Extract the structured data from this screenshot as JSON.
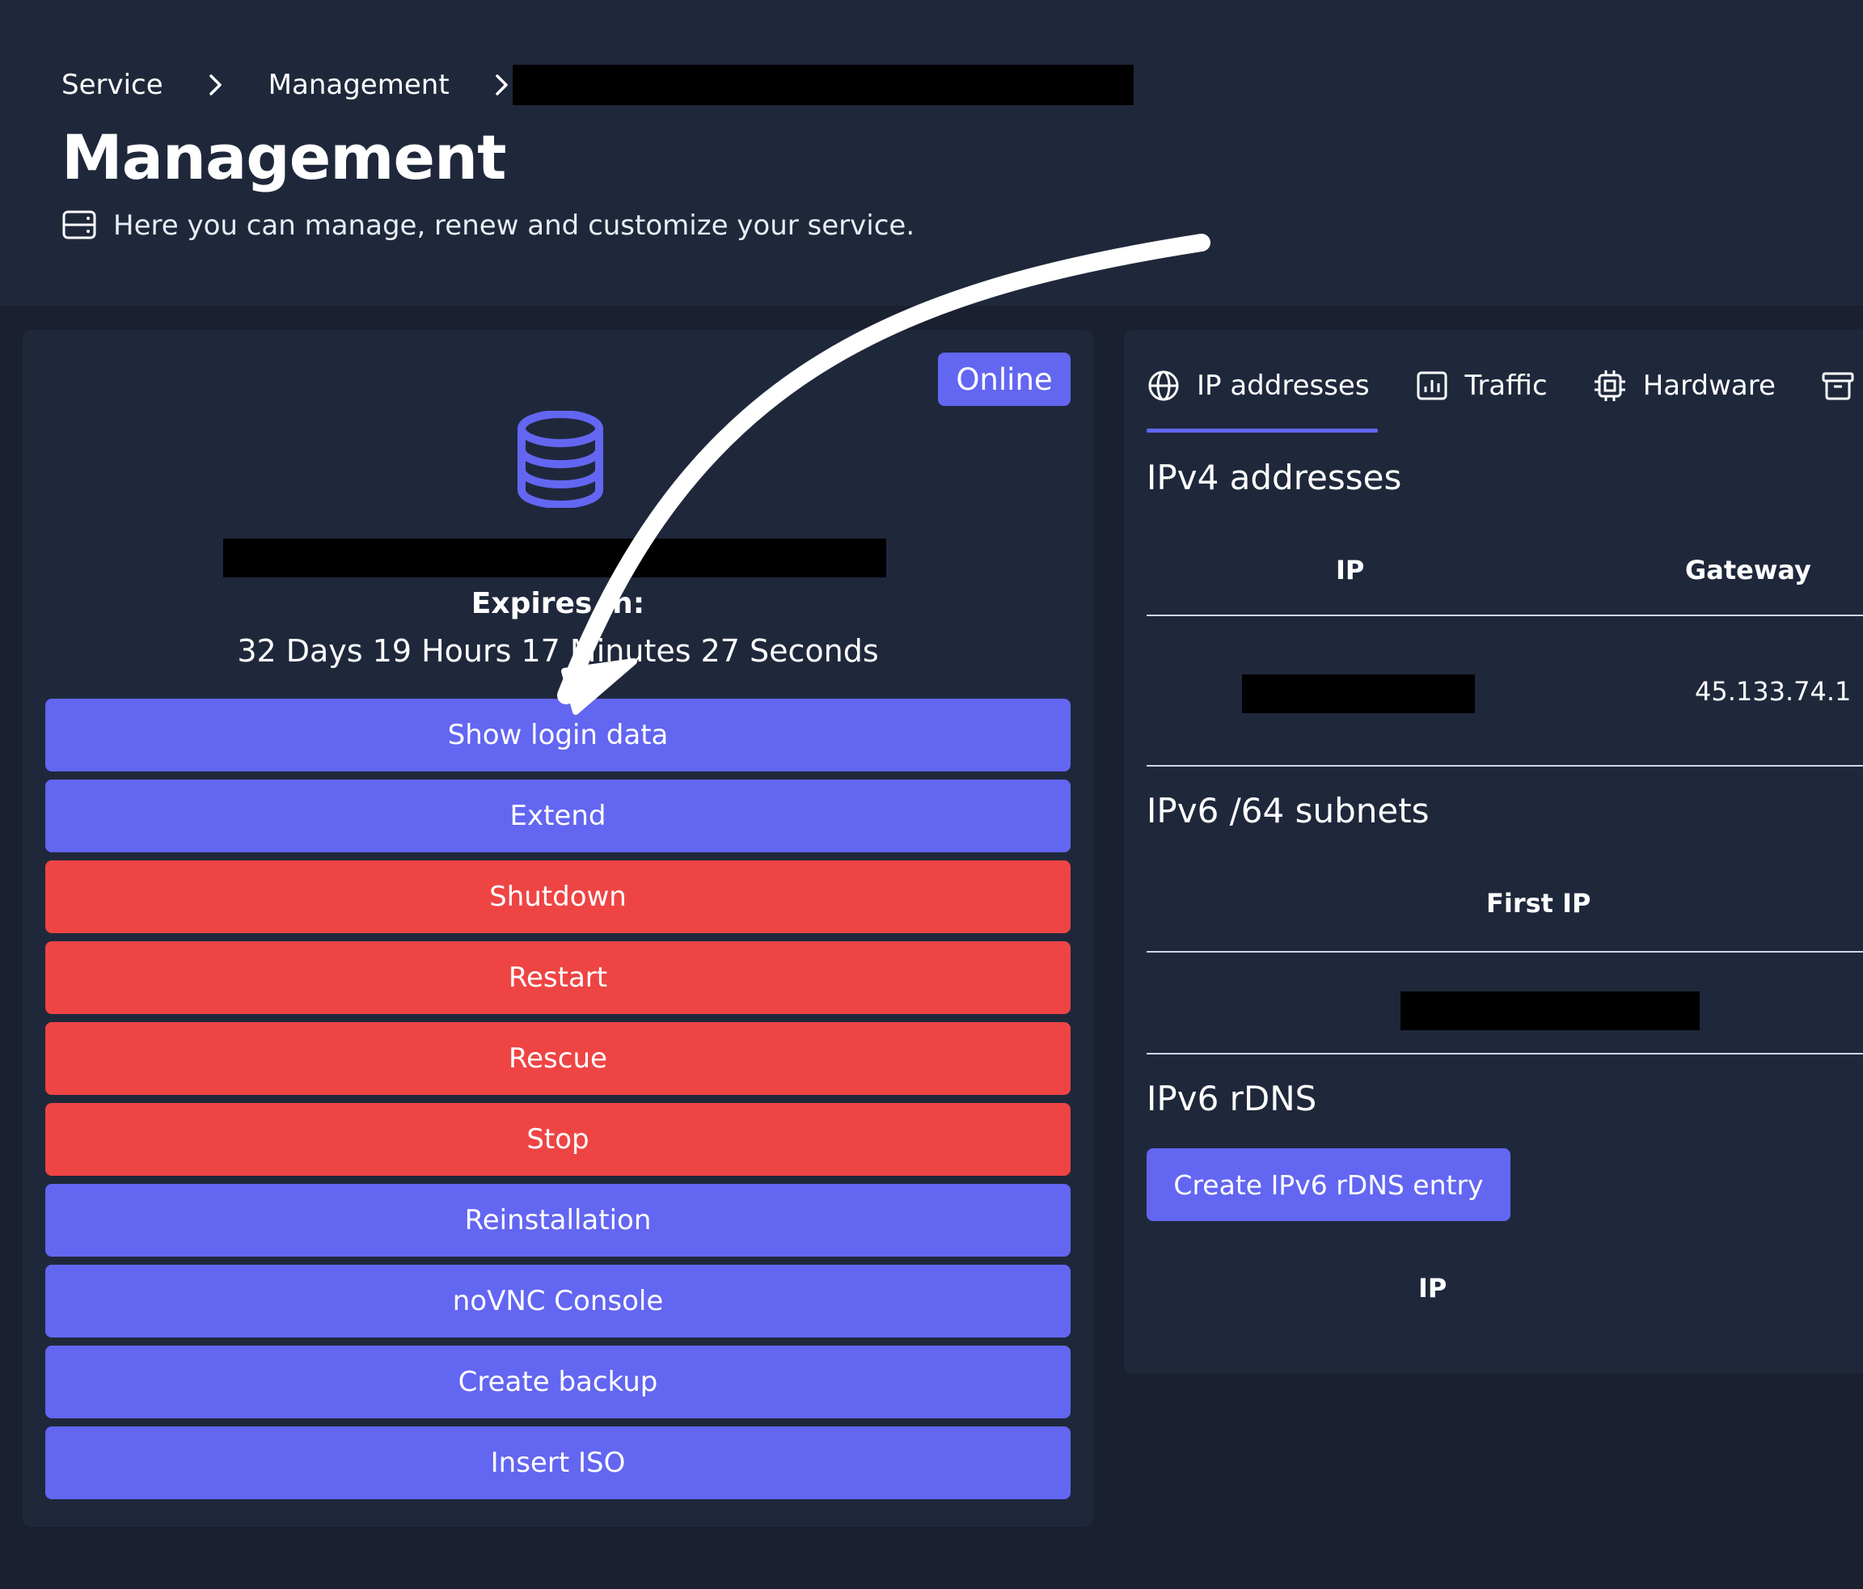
{
  "breadcrumb": {
    "items": [
      "Service",
      "Management"
    ]
  },
  "page": {
    "title": "Management",
    "subtitle": "Here you can manage, renew and customize your service."
  },
  "service_card": {
    "status": "Online",
    "expires_label": "Expires in:",
    "expires_value": "32 Days 19 Hours 17 Minutes 27 Seconds",
    "icon": "database-icon",
    "actions": [
      {
        "label": "Show login data",
        "style": "primary"
      },
      {
        "label": "Extend",
        "style": "primary"
      },
      {
        "label": "Shutdown",
        "style": "danger"
      },
      {
        "label": "Restart",
        "style": "danger"
      },
      {
        "label": "Rescue",
        "style": "danger"
      },
      {
        "label": "Stop",
        "style": "danger"
      },
      {
        "label": "Reinstallation",
        "style": "primary"
      },
      {
        "label": "noVNC Console",
        "style": "primary"
      },
      {
        "label": "Create backup",
        "style": "primary"
      },
      {
        "label": "Insert ISO",
        "style": "primary"
      }
    ]
  },
  "network_panel": {
    "tabs": [
      {
        "label": "IP addresses",
        "icon": "globe-icon",
        "active": true
      },
      {
        "label": "Traffic",
        "icon": "chart-icon",
        "active": false
      },
      {
        "label": "Hardware",
        "icon": "cpu-icon",
        "active": false
      },
      {
        "label": "",
        "icon": "archive-icon",
        "active": false
      }
    ],
    "ipv4": {
      "title": "IPv4 addresses",
      "columns": [
        "IP",
        "Gateway"
      ],
      "rows": [
        {
          "gateway": "45.133.74.1"
        }
      ]
    },
    "ipv6_subnets": {
      "title": "IPv6 /64 subnets",
      "columns": [
        "First IP"
      ]
    },
    "ipv6_rdns": {
      "title": "IPv6 rDNS",
      "create_button": "Create IPv6 rDNS entry",
      "columns": [
        "IP"
      ]
    }
  },
  "colors": {
    "accent": "#6366f1",
    "danger": "#ef4444",
    "page_bg": "#1a2030",
    "panel_bg": "#1f283b"
  }
}
